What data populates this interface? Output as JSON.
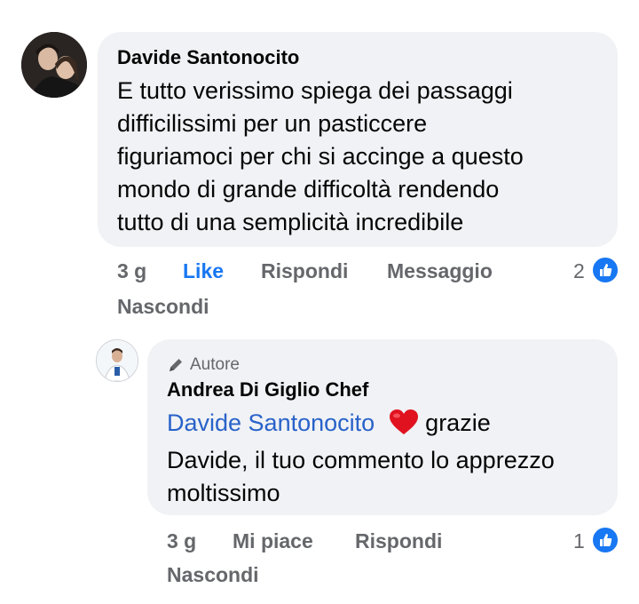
{
  "comment": {
    "author": "Davide Santonocito",
    "lines": [
      "E tutto verissimo spiega dei passaggi",
      "difficilissimi per un pasticcere",
      "figuriamoci per chi si accinge a questo",
      "mondo di grande difficoltà rendendo",
      "tutto di una semplicità incredibile"
    ],
    "time": "3 g",
    "like_label": "Like",
    "reply_label": "Rispondi",
    "message_label": "Messaggio",
    "hide_label": "Nascondi",
    "reaction_count": "2",
    "like_icon": "thumbs-up-icon"
  },
  "reply": {
    "badge_icon": "pencil-icon",
    "badge_label": "Autore",
    "author": "Andrea Di Giglio Chef",
    "mention": "Davide Santonocito",
    "heart_icon": "red-heart-emoji",
    "line1_rest": " grazie",
    "line2": "Davide, il tuo commento lo apprezzo",
    "line3": "moltissimo",
    "time": "3 g",
    "like_label": "Mi piace",
    "reply_label": "Rispondi",
    "hide_label": "Nascondi",
    "reaction_count": "1",
    "like_icon": "thumbs-up-icon"
  },
  "colors": {
    "bubble": "#f0f2f5",
    "link": "#1877f2",
    "mention": "#2962c9",
    "meta": "#65676b"
  }
}
